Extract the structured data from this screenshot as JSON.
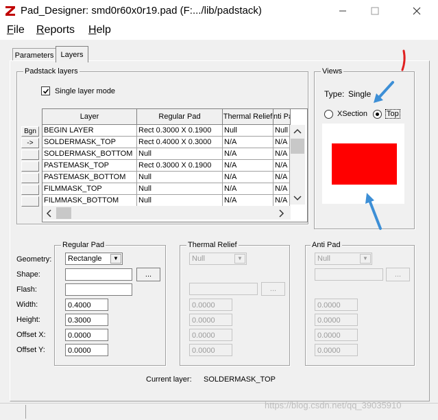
{
  "window": {
    "title": "Pad_Designer: smd0r60x0r19.pad (F:.../lib/padstack)",
    "minimize_icon": "minimize-icon",
    "maximize_icon": "maximize-icon",
    "close_icon": "close-icon"
  },
  "menu": {
    "file": {
      "accel": "F",
      "rest": "ile"
    },
    "reports": {
      "accel": "R",
      "rest": "eports"
    },
    "help": {
      "accel": "H",
      "rest": "elp"
    }
  },
  "tabs": [
    {
      "label": "Parameters",
      "active": false
    },
    {
      "label": "Layers",
      "active": true
    }
  ],
  "padstack_layers": {
    "group_label": "Padstack layers",
    "single_layer_mode_label": "Single layer mode",
    "single_layer_mode_checked": true,
    "columns": [
      "Layer",
      "Regular Pad",
      "Thermal Relief",
      "nti Pa"
    ],
    "row_buttons": [
      "Bgn",
      "->",
      "",
      "",
      "",
      "",
      ""
    ],
    "rows": [
      [
        "BEGIN LAYER",
        "Rect 0.3000 X 0.1900",
        "Null",
        "Null"
      ],
      [
        "SOLDERMASK_TOP",
        "Rect 0.4000 X 0.3000",
        "N/A",
        "N/A"
      ],
      [
        "SOLDERMASK_BOTTOM",
        "Null",
        "N/A",
        "N/A"
      ],
      [
        "PASTEMASK_TOP",
        "Rect 0.3000 X 0.1900",
        "N/A",
        "N/A"
      ],
      [
        "PASTEMASK_BOTTOM",
        "Null",
        "N/A",
        "N/A"
      ],
      [
        "FILMMASK_TOP",
        "Null",
        "N/A",
        "N/A"
      ],
      [
        "FILMMASK_BOTTOM",
        "Null",
        "N/A",
        "N/A"
      ]
    ]
  },
  "views": {
    "group_label": "Views",
    "type_label": "Type:",
    "type_value": "Single",
    "xsection_label": "XSection",
    "top_label": "Top",
    "selected": "Top",
    "pad_color": "#ff0000",
    "annotation_color": "#3d8fd6",
    "red_mark_color": "#e02020"
  },
  "regular_pad": {
    "group_label": "Regular Pad",
    "geometry_label": "Geometry:",
    "geometry_value": "Rectangle",
    "shape_label": "Shape:",
    "shape_value": "",
    "flash_label": "Flash:",
    "flash_value": "",
    "width_label": "Width:",
    "width_value": "0.4000",
    "height_label": "Height:",
    "height_value": "0.3000",
    "offset_x_label": "Offset X:",
    "offset_x_value": "0.0000",
    "offset_y_label": "Offset Y:",
    "offset_y_value": "0.0000",
    "browse_label": "..."
  },
  "thermal_relief": {
    "group_label": "Thermal Relief",
    "geometry_value": "Null",
    "shape_value": "",
    "browse_label": "...",
    "width_value": "0.0000",
    "height_value": "0.0000",
    "offset_x_value": "0.0000",
    "offset_y_value": "0.0000"
  },
  "anti_pad": {
    "group_label": "Anti Pad",
    "geometry_value": "Null",
    "shape_value": "",
    "browse_label": "...",
    "width_value": "0.0000",
    "height_value": "0.0000",
    "offset_x_value": "0.0000",
    "offset_y_value": "0.0000"
  },
  "current_layer": {
    "label": "Current layer:",
    "value": "SOLDERMASK_TOP"
  },
  "watermark": "https://blog.csdn.net/qq_39035910"
}
